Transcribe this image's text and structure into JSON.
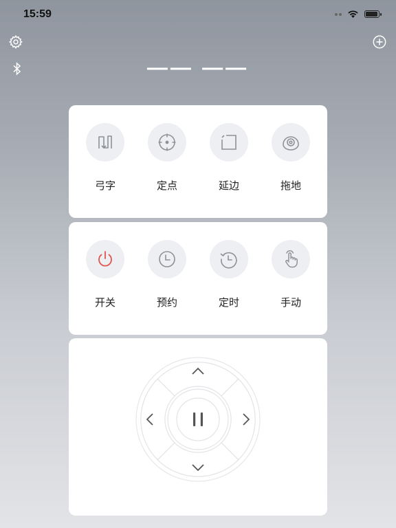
{
  "statusbar": {
    "time": "15:59"
  },
  "header": {
    "device_status": "—— ——"
  },
  "modes": [
    {
      "label": "弓字",
      "icon": "zigzag-icon"
    },
    {
      "label": "定点",
      "icon": "spot-icon"
    },
    {
      "label": "延边",
      "icon": "edge-icon"
    },
    {
      "label": "拖地",
      "icon": "mop-icon"
    }
  ],
  "controls": [
    {
      "label": "开关",
      "icon": "power-icon",
      "color": "#e0554f"
    },
    {
      "label": "预约",
      "icon": "clock-icon"
    },
    {
      "label": "定时",
      "icon": "timer-icon"
    },
    {
      "label": "手动",
      "icon": "hand-icon"
    }
  ],
  "colors": {
    "icon_gray": "#8e9196",
    "power_red": "#e0554f"
  }
}
